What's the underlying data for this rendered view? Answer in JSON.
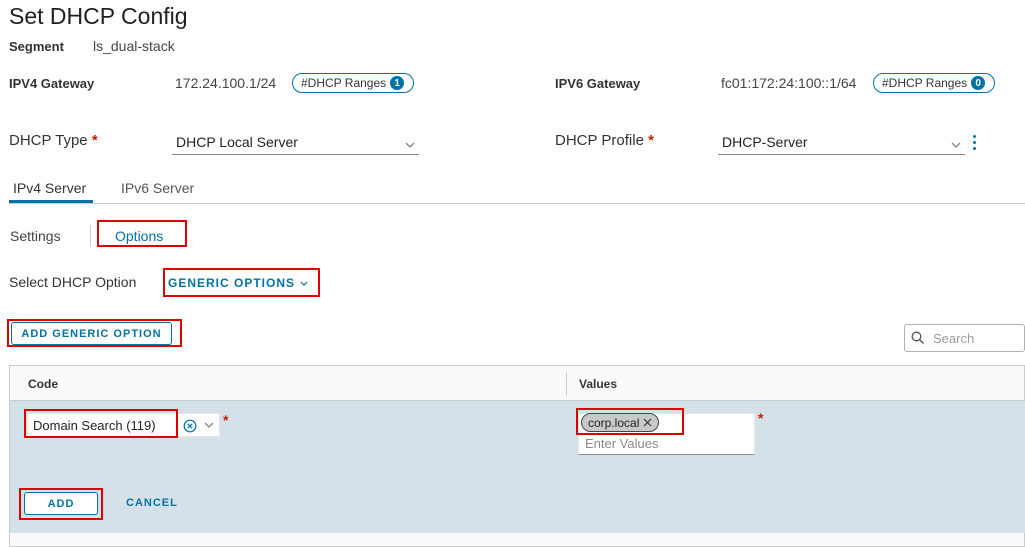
{
  "header": {
    "title": "Set DHCP Config"
  },
  "segment": {
    "label": "Segment",
    "value": "ls_dual-stack"
  },
  "ipv4": {
    "label": "IPV4 Gateway",
    "value": "172.24.100.1/24",
    "ranges_label": "#DHCP Ranges",
    "ranges_count": "1"
  },
  "ipv6": {
    "label": "IPV6 Gateway",
    "value": "fc01:172:24:100::1/64",
    "ranges_label": "#DHCP Ranges",
    "ranges_count": "0"
  },
  "dhcp_type": {
    "label": "DHCP Type",
    "required": "*",
    "value": "DHCP Local Server"
  },
  "dhcp_profile": {
    "label": "DHCP Profile",
    "required": "*",
    "value": "DHCP-Server"
  },
  "server_tabs": [
    {
      "label": "IPv4 Server",
      "active": true
    },
    {
      "label": "IPv6 Server",
      "active": false
    }
  ],
  "sub_tabs": [
    {
      "label": "Settings"
    },
    {
      "label": "Options"
    }
  ],
  "option_select": {
    "label": "Select DHCP Option",
    "value": "GENERIC OPTIONS"
  },
  "add_generic_button": "ADD GENERIC OPTION",
  "search": {
    "placeholder": "Search"
  },
  "grid": {
    "columns": [
      "Code",
      "Values"
    ],
    "edit_row": {
      "code_value": "Domain Search (119)",
      "required": "*",
      "chip": "corp.local",
      "values_placeholder": "Enter Values"
    }
  },
  "actions": {
    "add": "ADD",
    "cancel": "CANCEL"
  },
  "colors": {
    "accent": "#0072a3",
    "highlight": "#e00000",
    "required": "#c21d00",
    "row_bg": "#d5e1e8"
  }
}
